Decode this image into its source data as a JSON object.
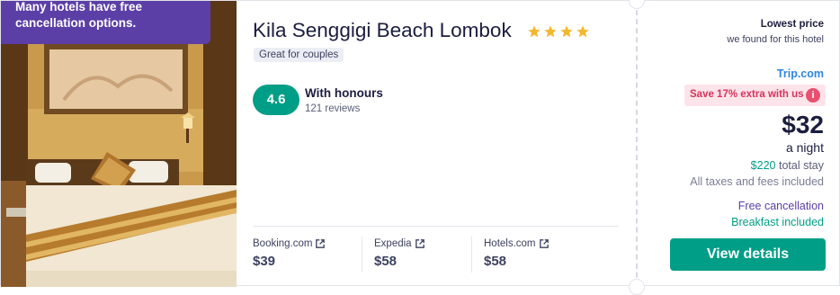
{
  "promo": {
    "text_line1": "Many hotels have free",
    "text_line2": "cancellation options."
  },
  "hotel": {
    "name": "Kila Senggigi Beach Lombok",
    "stars": 4,
    "tag": "Great for couples",
    "score": "4.6",
    "rating_label": "With honours",
    "reviews": "121 reviews"
  },
  "otas": [
    {
      "name": "Booking.com",
      "price": "$39"
    },
    {
      "name": "Expedia",
      "price": "$58"
    },
    {
      "name": "Hotels.com",
      "price": "$58"
    }
  ],
  "deal": {
    "lowest_title": "Lowest price",
    "lowest_sub": "we found for this hotel",
    "provider": "Trip.com",
    "save_badge": "Save 17% extra with us",
    "price": "$32",
    "per_night": "a night",
    "total_amount": "$220",
    "total_label": "total stay",
    "taxes": "All taxes and fees included",
    "free_cancellation": "Free cancellation",
    "breakfast": "Breakfast included",
    "cta": "View details"
  },
  "colors": {
    "accent_green": "#009e86",
    "promo_purple": "#5b3fa6",
    "star_gold": "#f5b731",
    "badge_pink": "#d6335c",
    "provider_blue": "#2e86de"
  }
}
